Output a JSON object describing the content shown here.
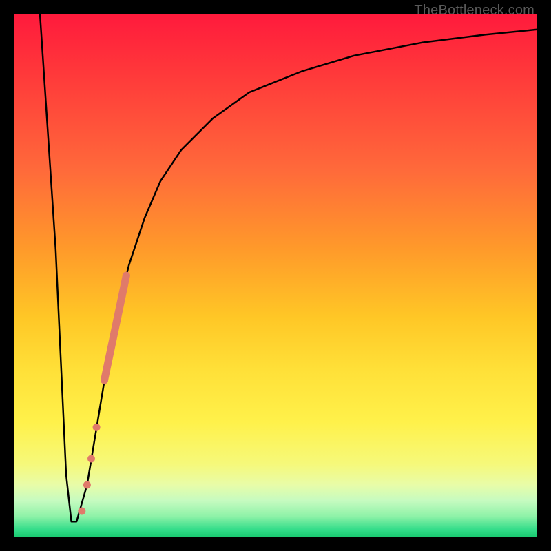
{
  "watermark": "TheBottleneck.com",
  "colors": {
    "frame": "#000000",
    "curve": "#000000",
    "markers": "#e07a6a"
  },
  "chart_data": {
    "type": "line",
    "title": "",
    "xlabel": "",
    "ylabel": "",
    "xlim": [
      0,
      100
    ],
    "ylim": [
      0,
      100
    ],
    "grid": false,
    "series": [
      {
        "name": "bottleneck-curve",
        "x": [
          5,
          8,
          10,
          11,
          12,
          14,
          16,
          18,
          20,
          22,
          25,
          28,
          32,
          38,
          45,
          55,
          65,
          78,
          90,
          100
        ],
        "y": [
          100,
          55,
          12,
          3,
          3,
          10,
          22,
          34,
          44,
          52,
          61,
          68,
          74,
          80,
          85,
          89,
          92,
          94.5,
          96,
          97
        ]
      }
    ],
    "markers": {
      "name": "highlight-points",
      "points": [
        {
          "x": 13.0,
          "y": 5
        },
        {
          "x": 14.0,
          "y": 10
        },
        {
          "x": 14.8,
          "y": 15
        },
        {
          "x": 15.8,
          "y": 21
        },
        {
          "x": 17.3,
          "y": 30
        }
      ],
      "band": {
        "from": {
          "x": 17.3,
          "y": 30
        },
        "to": {
          "x": 21.5,
          "y": 50
        },
        "width": 11
      }
    }
  }
}
